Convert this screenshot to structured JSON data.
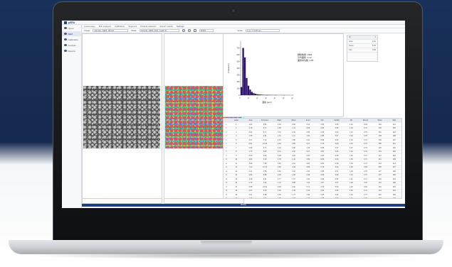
{
  "app": {
    "title": "pSEA"
  },
  "sidebar": {
    "items": [
      {
        "label": "Home",
        "icon": "home-icon",
        "active": false
      },
      {
        "label": "SEM",
        "icon": "image-icon",
        "active": true
      },
      {
        "label": "Calibration",
        "icon": "ruler-icon",
        "active": false
      },
      {
        "label": "Analysis",
        "icon": "chart-icon",
        "active": false
      },
      {
        "label": "Reports",
        "icon": "report-icon",
        "active": false
      }
    ]
  },
  "menubar": {
    "items": [
      "Load image",
      "Run analysis",
      "Calibration",
      "Segment",
      "Particle statistics",
      "Export results",
      "Settings"
    ]
  },
  "toolbar": {
    "image_label": "Image",
    "image_value": "sample_SEM_001.tif",
    "mask_label": "Mask",
    "mask_value": "sample_SEM_001_mask.tif",
    "zoom_value": "100%",
    "scale_label": "Scale",
    "scale_value": "1 px = 0.05 µm"
  },
  "chart_data": {
    "type": "bar",
    "title": "",
    "xlabel": "面积 (µm²)",
    "ylabel": "Frequency",
    "categories": [
      "0",
      "2",
      "4",
      "6",
      "8",
      "10",
      "12",
      "14",
      "16",
      "18",
      "20",
      "22",
      "24",
      "26",
      "28",
      "30",
      "32",
      "34",
      "36",
      "38",
      "40",
      "42",
      "44",
      "46",
      "48",
      "50",
      "52",
      "54",
      "56",
      "58"
    ],
    "values": [
      120,
      700,
      560,
      255,
      140,
      82,
      48,
      30,
      20,
      14,
      10,
      8,
      6,
      5,
      4,
      4,
      3,
      3,
      2,
      2,
      2,
      1,
      1,
      1,
      1,
      1,
      0,
      1,
      0,
      1
    ],
    "ylim": [
      0,
      800
    ],
    "yticks": [
      "0",
      "100",
      "200",
      "300",
      "400",
      "500",
      "600",
      "700"
    ],
    "xticks": [
      "0",
      "10",
      "20",
      "30",
      "40",
      "50",
      "60"
    ],
    "stats": [
      "颗粒数量: 2354",
      "平均面积: 4.12",
      "面积中位数: 2.81"
    ]
  },
  "legend_table": {
    "rows": [
      [
        "ID",
        "1"
      ],
      [
        "Area",
        "4.62"
      ],
      [
        "Perim.",
        "8.35"
      ],
      [
        "Circ.",
        "0.83"
      ]
    ]
  },
  "table": {
    "headers": [
      "Label",
      "Area",
      "Perimeter",
      "Major",
      "Minor",
      "Feret",
      "Circ.",
      "Solidity",
      "AR",
      "Round",
      "Mean",
      "Max"
    ],
    "rows": [
      [
        "1",
        "4.62",
        "8.35",
        "2.91",
        "2.02",
        "3.12",
        "0.83",
        "0.95",
        "1.44",
        "0.69",
        "142",
        "211"
      ],
      [
        "2",
        "2.18",
        "5.71",
        "1.96",
        "1.41",
        "2.08",
        "0.84",
        "0.96",
        "1.39",
        "0.72",
        "136",
        "205"
      ],
      [
        "3",
        "6.04",
        "9.77",
        "3.31",
        "2.32",
        "3.55",
        "0.80",
        "0.94",
        "1.43",
        "0.70",
        "151",
        "223"
      ],
      [
        "4",
        "1.25",
        "4.31",
        "1.43",
        "1.11",
        "1.52",
        "0.85",
        "0.97",
        "1.29",
        "0.78",
        "128",
        "198"
      ],
      [
        "5",
        "3.47",
        "7.12",
        "2.45",
        "1.80",
        "2.61",
        "0.86",
        "0.96",
        "1.36",
        "0.73",
        "139",
        "207"
      ],
      [
        "6",
        "8.91",
        "11.93",
        "4.02",
        "2.82",
        "4.27",
        "0.79",
        "0.93",
        "1.43",
        "0.70",
        "158",
        "231"
      ],
      [
        "7",
        "0.96",
        "3.74",
        "1.24",
        "0.98",
        "1.33",
        "0.86",
        "0.97",
        "1.27",
        "0.79",
        "125",
        "190"
      ],
      [
        "8",
        "2.73",
        "6.29",
        "2.14",
        "1.62",
        "2.27",
        "0.87",
        "0.96",
        "1.32",
        "0.76",
        "134",
        "202"
      ],
      [
        "9",
        "5.33",
        "9.05",
        "3.08",
        "2.20",
        "3.30",
        "0.82",
        "0.95",
        "1.40",
        "0.71",
        "147",
        "218"
      ],
      [
        "10",
        "1.84",
        "5.18",
        "1.78",
        "1.32",
        "1.89",
        "0.86",
        "0.96",
        "1.35",
        "0.74",
        "131",
        "199"
      ],
      [
        "11",
        "3.95",
        "7.68",
        "2.63",
        "1.91",
        "2.80",
        "0.84",
        "0.95",
        "1.38",
        "0.73",
        "143",
        "213"
      ],
      [
        "12",
        "7.12",
        "10.70",
        "3.66",
        "2.48",
        "3.88",
        "0.78",
        "0.93",
        "1.48",
        "0.68",
        "155",
        "227"
      ],
      [
        "13",
        "1.41",
        "4.55",
        "1.52",
        "1.18",
        "1.61",
        "0.86",
        "0.97",
        "1.29",
        "0.78",
        "127",
        "195"
      ],
      [
        "14",
        "2.96",
        "6.58",
        "2.24",
        "1.68",
        "2.38",
        "0.86",
        "0.96",
        "1.33",
        "0.75",
        "137",
        "206"
      ],
      [
        "15",
        "4.28",
        "8.01",
        "2.77",
        "1.97",
        "2.94",
        "0.84",
        "0.95",
        "1.41",
        "0.71",
        "145",
        "215"
      ],
      [
        "16",
        "0.78",
        "3.36",
        "1.13",
        "0.88",
        "1.20",
        "0.87",
        "0.97",
        "1.28",
        "0.78",
        "122",
        "188"
      ],
      [
        "17",
        "6.55",
        "10.22",
        "3.48",
        "2.40",
        "3.71",
        "0.79",
        "0.94",
        "1.45",
        "0.69",
        "152",
        "225"
      ],
      [
        "18",
        "2.37",
        "5.94",
        "2.02",
        "1.49",
        "2.15",
        "0.84",
        "0.96",
        "1.36",
        "0.74",
        "133",
        "201"
      ],
      [
        "19",
        "3.21",
        "6.88",
        "2.36",
        "1.73",
        "2.50",
        "0.85",
        "0.96",
        "1.36",
        "0.73",
        "140",
        "209"
      ],
      [
        "20",
        "1.09",
        "4.02",
        "1.35",
        "1.03",
        "1.43",
        "0.85",
        "0.97",
        "1.31",
        "0.76",
        "126",
        "193"
      ]
    ]
  },
  "statusbar": {
    "text": "Ready"
  }
}
